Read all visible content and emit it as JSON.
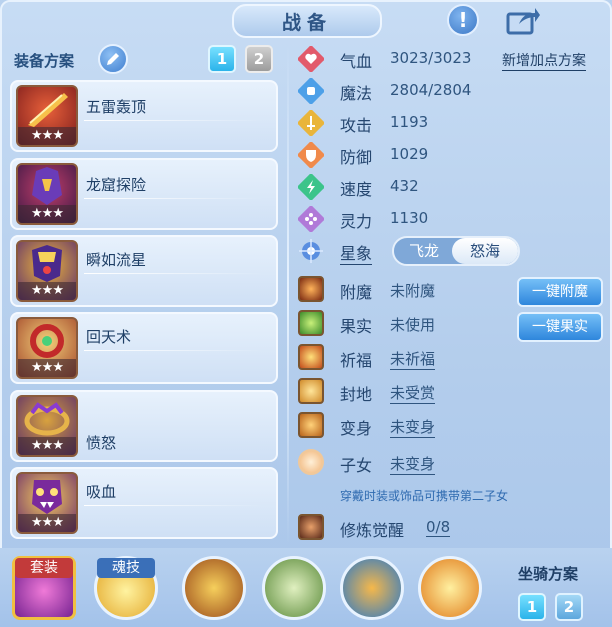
{
  "title": "战备",
  "header": {
    "alert_icon": "exclamation-icon",
    "share_icon": "share-icon"
  },
  "equipment_plan": {
    "label": "装备方案",
    "tabs": [
      "1",
      "2"
    ],
    "active_tab": "1"
  },
  "equipment": [
    {
      "name": "五雷轰顶",
      "stars": "★★★",
      "icon": "red-blade-icon"
    },
    {
      "name": "龙窟探险",
      "stars": "★★★",
      "icon": "purple-armor-icon"
    },
    {
      "name": "瞬如流星",
      "stars": "★★★",
      "icon": "gold-armor-icon"
    },
    {
      "name": "回天术",
      "stars": "★★★",
      "icon": "red-ring-icon"
    },
    {
      "name": "愤怒",
      "stars": "★★★",
      "icon": "crown-ring-icon"
    },
    {
      "name": "吸血",
      "stars": "★★★",
      "icon": "fanged-mask-icon"
    }
  ],
  "stats": [
    {
      "name": "气血",
      "value": "3023/3023",
      "icon": "heart-icon",
      "color": "#e25a6b"
    },
    {
      "name": "魔法",
      "value": "2804/2804",
      "icon": "mana-icon",
      "color": "#4da0e8"
    },
    {
      "name": "攻击",
      "value": "1193",
      "icon": "sword-icon",
      "color": "#e9b53b"
    },
    {
      "name": "防御",
      "value": "1029",
      "icon": "shield-icon",
      "color": "#f08a4b"
    },
    {
      "name": "速度",
      "value": "432",
      "icon": "speed-icon",
      "color": "#3cc48a"
    },
    {
      "name": "灵力",
      "value": "1130",
      "icon": "spirit-icon",
      "color": "#b07ad8"
    }
  ],
  "add_points_label": "新增加点方案",
  "star_sign": {
    "label": "星象",
    "options": [
      "飞龙",
      "怒海"
    ],
    "selected": "怒海"
  },
  "attributes": [
    {
      "name": "附魔",
      "value": "未附魔",
      "icon": "enchant-icon",
      "underline": false
    },
    {
      "name": "果实",
      "value": "未使用",
      "icon": "fruit-icon",
      "underline": false
    },
    {
      "name": "祈福",
      "value": "未祈福",
      "icon": "blessing-icon",
      "underline": true
    },
    {
      "name": "封地",
      "value": "未受赏",
      "icon": "fief-icon",
      "underline": true
    },
    {
      "name": "变身",
      "value": "未变身",
      "icon": "transform-icon",
      "underline": true
    },
    {
      "name": "子女",
      "value": "未变身",
      "icon": "child-icon",
      "underline": true
    }
  ],
  "buttons": {
    "one_key_enchant": "一键附魔",
    "one_key_fruit": "一键果实"
  },
  "hint_text": "穿戴时装或饰品可携带第二子女",
  "cultivation": {
    "name": "修炼觉醒",
    "value": "0/8",
    "icon": "cultivation-icon"
  },
  "bottom": {
    "outfit_label": "套装",
    "soul_skill_label": "魂技",
    "skills": [
      "fist-skill-icon",
      "sword-skill-icon",
      "wave-skill-icon",
      "dash-skill-icon"
    ],
    "mount_plan_label": "坐骑方案",
    "mount_tabs": [
      "1",
      "2"
    ]
  }
}
